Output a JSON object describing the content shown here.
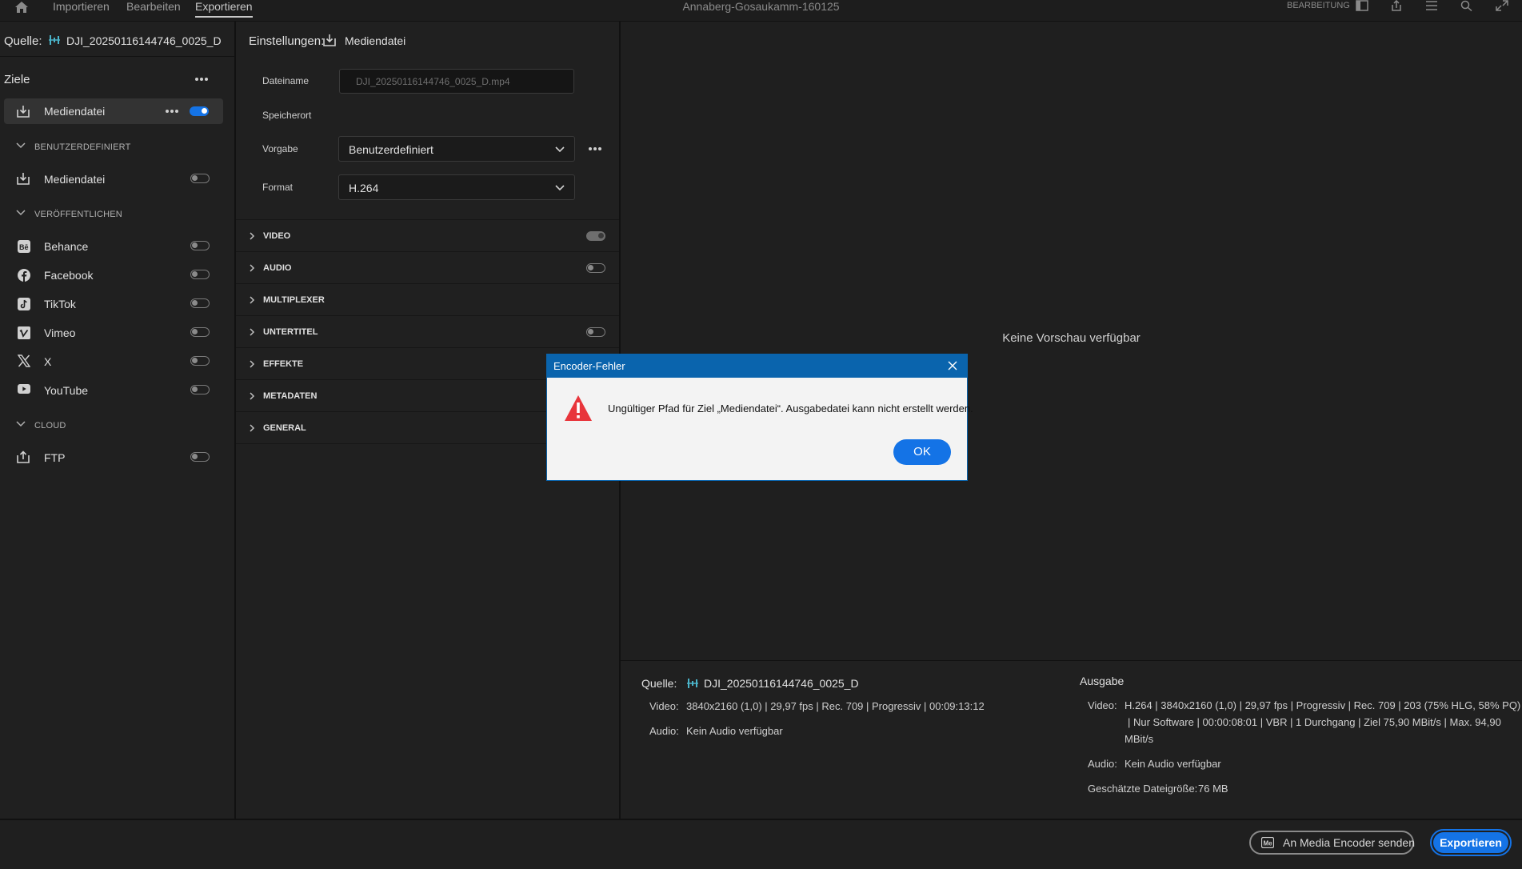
{
  "topbar": {
    "tabs": [
      "Importieren",
      "Bearbeiten",
      "Exportieren"
    ],
    "active_tab": "Exportieren",
    "title": "Annaberg-Gosaukamm-160125",
    "workspace_label": "BEARBEITUNG"
  },
  "left": {
    "source_label": "Quelle:",
    "source_name": "DJI_20250116144746_0025_D",
    "targets_label": "Ziele",
    "active_target": {
      "label": "Mediendatei",
      "enabled": true
    },
    "sections": [
      {
        "title": "BENUTZERDEFINIERT",
        "items": [
          {
            "label": "Mediendatei",
            "icon": "download-icon",
            "enabled": false
          }
        ]
      },
      {
        "title": "VERÖFFENTLICHEN",
        "items": [
          {
            "label": "Behance",
            "icon": "behance-icon",
            "enabled": false
          },
          {
            "label": "Facebook",
            "icon": "facebook-icon",
            "enabled": false
          },
          {
            "label": "TikTok",
            "icon": "tiktok-icon",
            "enabled": false
          },
          {
            "label": "Vimeo",
            "icon": "vimeo-icon",
            "enabled": false
          },
          {
            "label": "X",
            "icon": "x-icon",
            "enabled": false
          },
          {
            "label": "YouTube",
            "icon": "youtube-icon",
            "enabled": false
          }
        ]
      },
      {
        "title": "CLOUD",
        "items": [
          {
            "label": "FTP",
            "icon": "upload-icon",
            "enabled": false
          }
        ]
      }
    ]
  },
  "settings": {
    "header_label": "Einstellungen:",
    "header_target": "Mediendatei",
    "filename_label": "Dateiname",
    "filename_value": "DJI_20250116144746_0025_D.mp4",
    "location_label": "Speicherort",
    "preset_label": "Vorgabe",
    "preset_value": "Benutzerdefiniert",
    "format_label": "Format",
    "format_value": "H.264",
    "accordions": [
      {
        "label": "VIDEO",
        "toggle": "on-grey"
      },
      {
        "label": "AUDIO",
        "toggle": "off"
      },
      {
        "label": "MULTIPLEXER",
        "toggle": "none"
      },
      {
        "label": "UNTERTITEL",
        "toggle": "off"
      },
      {
        "label": "EFFEKTE",
        "toggle": "none"
      },
      {
        "label": "METADATEN",
        "toggle": "none"
      },
      {
        "label": "GENERAL",
        "toggle": "none"
      }
    ]
  },
  "preview": {
    "no_preview": "Keine Vorschau verfügbar"
  },
  "summary": {
    "source": {
      "label": "Quelle:",
      "name": "DJI_20250116144746_0025_D",
      "video_label": "Video:",
      "video_value": "3840x2160 (1,0) | 29,97 fps | Rec. 709 | Progressiv | 00:09:13:12",
      "audio_label": "Audio:",
      "audio_value": "Kein Audio verfügbar"
    },
    "output": {
      "label": "Ausgabe",
      "video_label": "Video:",
      "video_line1": "H.264 | 3840x2160 (1,0) | 29,97 fps | Progressiv | Rec. 709 | 203 (75% HLG, 58% PQ)",
      "video_line2": "| Nur Software | 00:00:08:01 | VBR | 1 Durchgang | Ziel 75,90 MBit/s | Max. 94,90",
      "video_line3": "MBit/s",
      "audio_label": "Audio:",
      "audio_value": "Kein Audio verfügbar",
      "size_label": "Geschätzte Dateigröße:",
      "size_value": "76 MB"
    }
  },
  "footer": {
    "media_encoder_label": "An Media Encoder senden",
    "export_label": "Exportieren"
  },
  "dialog": {
    "title": "Encoder-Fehler",
    "message": "Ungültiger Pfad für Ziel „Mediendatei“. Ausgabedatei kann nicht erstellt werden.",
    "ok_label": "OK"
  },
  "colors": {
    "accent": "#1473e6",
    "dialog_title": "#0a64ad",
    "warning": "#e8353b"
  }
}
